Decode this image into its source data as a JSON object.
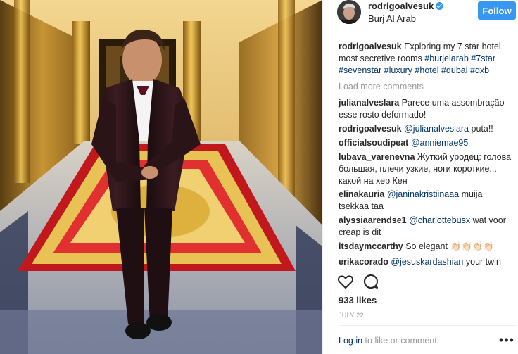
{
  "post": {
    "username": "rodrigoalvesuk",
    "location": "Burj Al Arab",
    "follow_label": "Follow",
    "caption": {
      "username": "rodrigoalvesuk",
      "text": "Exploring my 7 star hotel most secretive rooms",
      "hashtags": [
        "#burjelarab",
        "#7star",
        "#sevenstar",
        "#luxury",
        "#hotel",
        "#dubai",
        "#dxb"
      ]
    },
    "load_more": "Load more comments",
    "comments": [
      {
        "user": "julianalveslara",
        "mention": "",
        "text": "Parece uma assombração esse rosto deformado!"
      },
      {
        "user": "rodrigoalvesuk",
        "mention": "@julianalveslara",
        "text": "puta!!"
      },
      {
        "user": "officialsoudipeat",
        "mention": "@anniemae95",
        "text": ""
      },
      {
        "user": "lubava_varenevna",
        "mention": "",
        "text": "Жуткий уродец: голова большая, плечи узкие, ноги короткие... какой на хер Кен"
      },
      {
        "user": "elinakauria",
        "mention": "@janinakristiinaaa",
        "text": "muija tsekkaa tää"
      },
      {
        "user": "alyssiaarendse1",
        "mention": "@charlottebusx",
        "text": "wat voor creap is dit"
      },
      {
        "user": "itsdaymccarthy",
        "mention": "",
        "text": "So elegant 👏🏻👏🏻👏🏻👏🏻"
      },
      {
        "user": "erikacorado",
        "mention": "@jesuskardashian",
        "text": "your twin"
      }
    ],
    "likes": "933 likes",
    "date": "JULY 22",
    "add_comment": {
      "login": "Log in",
      "rest": "to like or comment."
    },
    "more_label": "•••",
    "icons": {
      "like": "heart-icon",
      "comment": "comment-bubble-icon",
      "more": "more-options-icon",
      "verified": "verified-badge-icon"
    },
    "colors": {
      "accent": "#3897f0",
      "link": "#003569",
      "muted": "#999999",
      "text": "#262626"
    }
  }
}
